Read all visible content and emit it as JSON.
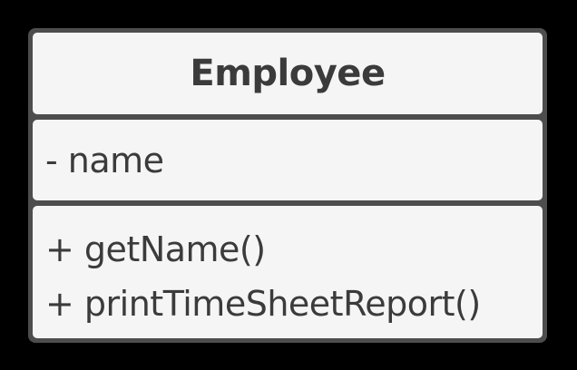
{
  "class_box": {
    "name": "Employee",
    "attributes": [
      "- name"
    ],
    "methods": [
      "+ getName()",
      "+ printTimeSheetReport()"
    ]
  },
  "colors": {
    "background": "#000000",
    "border": "#4d4d4d",
    "fill": "#f5f5f5",
    "text": "#3b3b3b"
  }
}
